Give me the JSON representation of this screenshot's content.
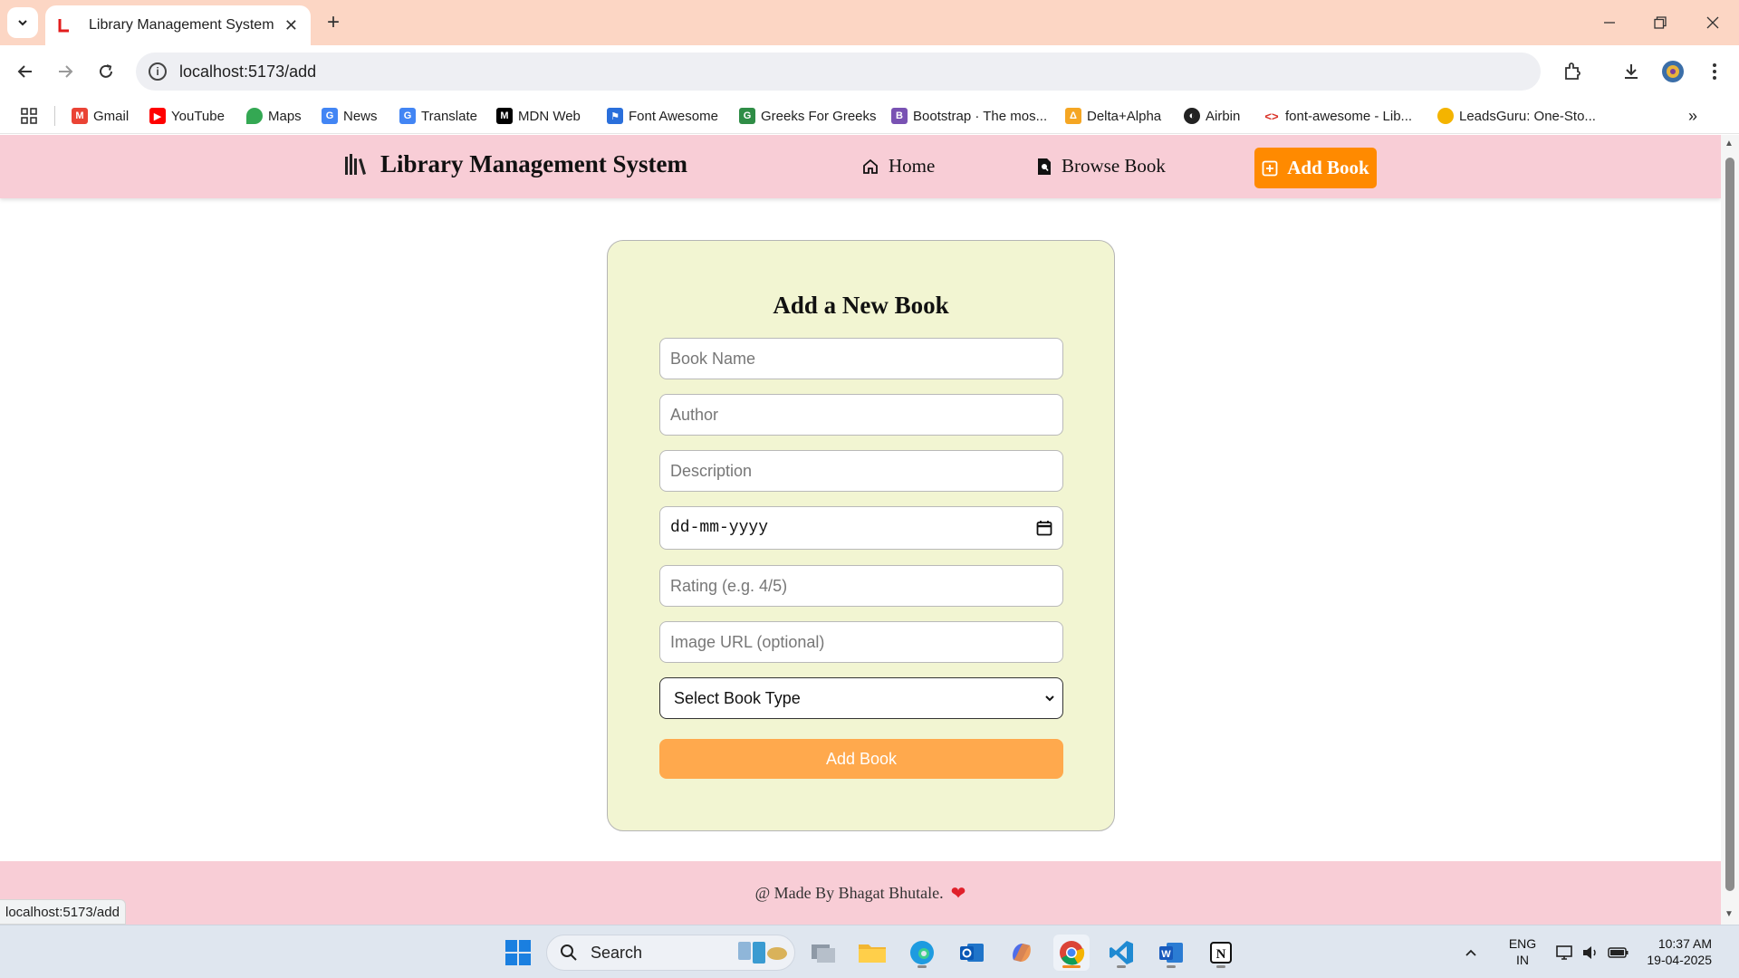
{
  "browser": {
    "tab_title": "Library Management System",
    "tab_close": "✕",
    "new_tab": "+",
    "url": "localhost:5173/add",
    "status_url": "localhost:5173/add",
    "window_controls": [
      "minimize-icon",
      "restore-icon",
      "close-icon"
    ]
  },
  "bookmarks": [
    {
      "label": "Gmail",
      "icon": "gmail-icon",
      "color": "#ea4335"
    },
    {
      "label": "YouTube",
      "icon": "youtube-icon",
      "color": "#ff0000"
    },
    {
      "label": "Maps",
      "icon": "maps-icon",
      "color": "#34a853"
    },
    {
      "label": "News",
      "icon": "news-icon",
      "color": "#4285f4"
    },
    {
      "label": "Translate",
      "icon": "translate-icon",
      "color": "#4285f4"
    },
    {
      "label": "MDN Web",
      "icon": "mdn-icon",
      "color": "#000000"
    },
    {
      "label": "Font Awesome",
      "icon": "font-awesome-icon",
      "color": "#2a6fdb"
    },
    {
      "label": "Greeks For Greeks",
      "icon": "gfg-icon",
      "color": "#2f8d46"
    },
    {
      "label": "Bootstrap · The mos...",
      "icon": "bootstrap-icon",
      "color": "#7952b3"
    },
    {
      "label": "Delta+Alpha",
      "icon": "delta-alpha-icon",
      "color": "#f5a623"
    },
    {
      "label": "Airbin",
      "icon": "airbin-icon",
      "color": "#222222"
    },
    {
      "label": "font-awesome - Lib...",
      "icon": "code-icon",
      "color": "#d93025"
    },
    {
      "label": "LeadsGuru: One-Sto...",
      "icon": "bulb-icon",
      "color": "#f4b400"
    }
  ],
  "header": {
    "brand": "Library Management System",
    "nav": [
      {
        "label": "Home",
        "icon": "home-icon"
      },
      {
        "label": "Browse Book",
        "icon": "search-book-icon"
      }
    ],
    "cta": "Add Book",
    "colors": {
      "header_bg": "#f8cdd6",
      "cta_bg": "#ff8a00"
    }
  },
  "form": {
    "title": "Add a New Book",
    "book_name_placeholder": "Book Name",
    "author_placeholder": "Author",
    "description_placeholder": "Description",
    "date_placeholder": "dd-mm-yyyy",
    "rating_placeholder": "Rating (e.g. 4/5)",
    "image_placeholder": "Image URL (optional)",
    "book_type_selected": "Select Book Type",
    "submit_label": "Add Book",
    "colors": {
      "card_bg": "#f2f5d2",
      "submit_bg": "#ffa94d"
    }
  },
  "footer": {
    "text": "@ Made By Bhagat Bhutale.",
    "heart": "❤"
  },
  "taskbar": {
    "search_label": "Search",
    "lang_top": "ENG",
    "lang_bottom": "IN",
    "time": "10:37 AM",
    "date": "19-04-2025"
  }
}
